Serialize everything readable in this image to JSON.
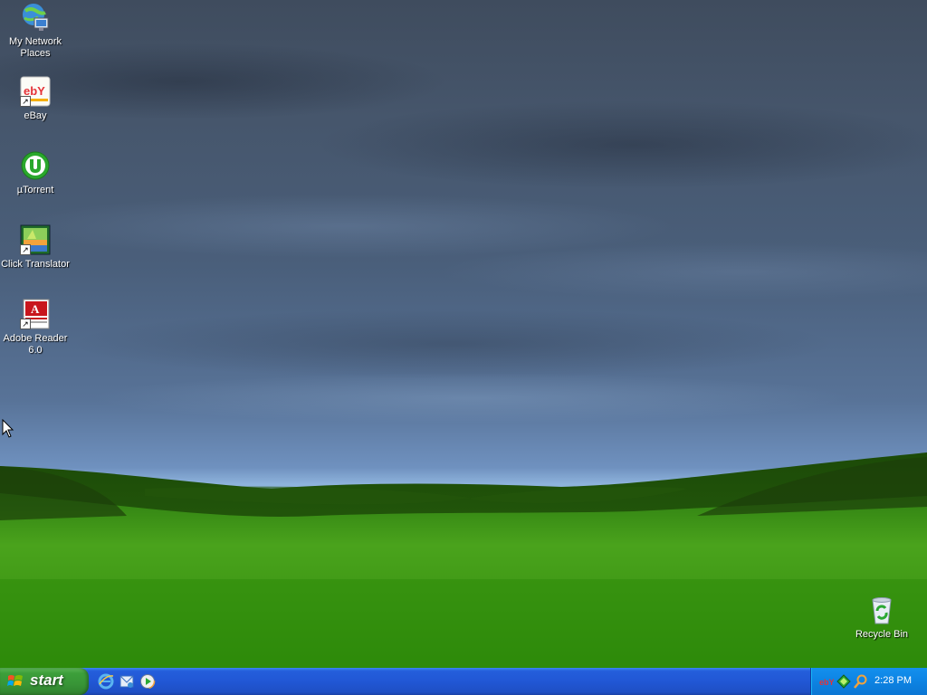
{
  "desktop": {
    "icons": [
      {
        "label": "My Network Places",
        "icon": "network-places-icon"
      },
      {
        "label": "eBay",
        "icon": "ebay-icon",
        "shortcut": true
      },
      {
        "label": "µTorrent",
        "icon": "utorrent-icon"
      },
      {
        "label": "Click Translator",
        "icon": "translator-icon",
        "shortcut": true
      },
      {
        "label": "Adobe Reader 6.0",
        "icon": "adobe-reader-icon",
        "shortcut": true
      }
    ],
    "recycle_bin": {
      "label": "Recycle Bin",
      "icon": "recycle-bin-icon"
    },
    "ebay_logo_text": "ebY",
    "adobe_logo_text": "A"
  },
  "taskbar": {
    "start_label": "start",
    "quick_launch": [
      "internet-explorer-icon",
      "outlook-express-icon",
      "media-player-icon"
    ],
    "tray": {
      "icons": [
        "ebay-tray-icon",
        "network-tray-icon",
        "search-tray-icon"
      ],
      "ebay_tray_text": "ebY",
      "clock": "2:28 PM"
    }
  },
  "colors": {
    "taskbar": "#245edb",
    "start_button": "#3c9f3a",
    "tray": "#0e86e6",
    "grass": "#3a9a14"
  }
}
